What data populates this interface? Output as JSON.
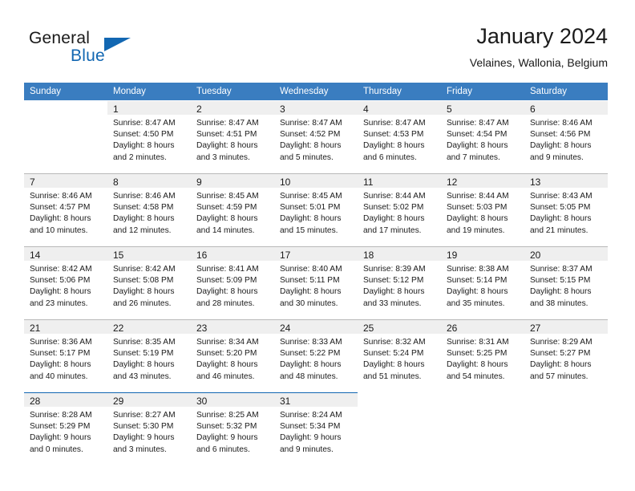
{
  "brand": {
    "word1": "General",
    "word2": "Blue",
    "logo_icon": "triangle-logo"
  },
  "header": {
    "month_title": "January 2024",
    "location": "Velaines, Wallonia, Belgium"
  },
  "calendar": {
    "weekday_headers": [
      "Sunday",
      "Monday",
      "Tuesday",
      "Wednesday",
      "Thursday",
      "Friday",
      "Saturday"
    ],
    "weeks": [
      [
        {
          "day": "",
          "lines": []
        },
        {
          "day": "1",
          "lines": [
            "Sunrise: 8:47 AM",
            "Sunset: 4:50 PM",
            "Daylight: 8 hours",
            "and 2 minutes."
          ]
        },
        {
          "day": "2",
          "lines": [
            "Sunrise: 8:47 AM",
            "Sunset: 4:51 PM",
            "Daylight: 8 hours",
            "and 3 minutes."
          ]
        },
        {
          "day": "3",
          "lines": [
            "Sunrise: 8:47 AM",
            "Sunset: 4:52 PM",
            "Daylight: 8 hours",
            "and 5 minutes."
          ]
        },
        {
          "day": "4",
          "lines": [
            "Sunrise: 8:47 AM",
            "Sunset: 4:53 PM",
            "Daylight: 8 hours",
            "and 6 minutes."
          ]
        },
        {
          "day": "5",
          "lines": [
            "Sunrise: 8:47 AM",
            "Sunset: 4:54 PM",
            "Daylight: 8 hours",
            "and 7 minutes."
          ]
        },
        {
          "day": "6",
          "lines": [
            "Sunrise: 8:46 AM",
            "Sunset: 4:56 PM",
            "Daylight: 8 hours",
            "and 9 minutes."
          ]
        }
      ],
      [
        {
          "day": "7",
          "lines": [
            "Sunrise: 8:46 AM",
            "Sunset: 4:57 PM",
            "Daylight: 8 hours",
            "and 10 minutes."
          ]
        },
        {
          "day": "8",
          "lines": [
            "Sunrise: 8:46 AM",
            "Sunset: 4:58 PM",
            "Daylight: 8 hours",
            "and 12 minutes."
          ]
        },
        {
          "day": "9",
          "lines": [
            "Sunrise: 8:45 AM",
            "Sunset: 4:59 PM",
            "Daylight: 8 hours",
            "and 14 minutes."
          ]
        },
        {
          "day": "10",
          "lines": [
            "Sunrise: 8:45 AM",
            "Sunset: 5:01 PM",
            "Daylight: 8 hours",
            "and 15 minutes."
          ]
        },
        {
          "day": "11",
          "lines": [
            "Sunrise: 8:44 AM",
            "Sunset: 5:02 PM",
            "Daylight: 8 hours",
            "and 17 minutes."
          ]
        },
        {
          "day": "12",
          "lines": [
            "Sunrise: 8:44 AM",
            "Sunset: 5:03 PM",
            "Daylight: 8 hours",
            "and 19 minutes."
          ]
        },
        {
          "day": "13",
          "lines": [
            "Sunrise: 8:43 AM",
            "Sunset: 5:05 PM",
            "Daylight: 8 hours",
            "and 21 minutes."
          ]
        }
      ],
      [
        {
          "day": "14",
          "lines": [
            "Sunrise: 8:42 AM",
            "Sunset: 5:06 PM",
            "Daylight: 8 hours",
            "and 23 minutes."
          ]
        },
        {
          "day": "15",
          "lines": [
            "Sunrise: 8:42 AM",
            "Sunset: 5:08 PM",
            "Daylight: 8 hours",
            "and 26 minutes."
          ]
        },
        {
          "day": "16",
          "lines": [
            "Sunrise: 8:41 AM",
            "Sunset: 5:09 PM",
            "Daylight: 8 hours",
            "and 28 minutes."
          ]
        },
        {
          "day": "17",
          "lines": [
            "Sunrise: 8:40 AM",
            "Sunset: 5:11 PM",
            "Daylight: 8 hours",
            "and 30 minutes."
          ]
        },
        {
          "day": "18",
          "lines": [
            "Sunrise: 8:39 AM",
            "Sunset: 5:12 PM",
            "Daylight: 8 hours",
            "and 33 minutes."
          ]
        },
        {
          "day": "19",
          "lines": [
            "Sunrise: 8:38 AM",
            "Sunset: 5:14 PM",
            "Daylight: 8 hours",
            "and 35 minutes."
          ]
        },
        {
          "day": "20",
          "lines": [
            "Sunrise: 8:37 AM",
            "Sunset: 5:15 PM",
            "Daylight: 8 hours",
            "and 38 minutes."
          ]
        }
      ],
      [
        {
          "day": "21",
          "lines": [
            "Sunrise: 8:36 AM",
            "Sunset: 5:17 PM",
            "Daylight: 8 hours",
            "and 40 minutes."
          ]
        },
        {
          "day": "22",
          "lines": [
            "Sunrise: 8:35 AM",
            "Sunset: 5:19 PM",
            "Daylight: 8 hours",
            "and 43 minutes."
          ]
        },
        {
          "day": "23",
          "lines": [
            "Sunrise: 8:34 AM",
            "Sunset: 5:20 PM",
            "Daylight: 8 hours",
            "and 46 minutes."
          ]
        },
        {
          "day": "24",
          "lines": [
            "Sunrise: 8:33 AM",
            "Sunset: 5:22 PM",
            "Daylight: 8 hours",
            "and 48 minutes."
          ]
        },
        {
          "day": "25",
          "lines": [
            "Sunrise: 8:32 AM",
            "Sunset: 5:24 PM",
            "Daylight: 8 hours",
            "and 51 minutes."
          ]
        },
        {
          "day": "26",
          "lines": [
            "Sunrise: 8:31 AM",
            "Sunset: 5:25 PM",
            "Daylight: 8 hours",
            "and 54 minutes."
          ]
        },
        {
          "day": "27",
          "lines": [
            "Sunrise: 8:29 AM",
            "Sunset: 5:27 PM",
            "Daylight: 8 hours",
            "and 57 minutes."
          ]
        }
      ],
      [
        {
          "day": "28",
          "lines": [
            "Sunrise: 8:28 AM",
            "Sunset: 5:29 PM",
            "Daylight: 9 hours",
            "and 0 minutes."
          ]
        },
        {
          "day": "29",
          "lines": [
            "Sunrise: 8:27 AM",
            "Sunset: 5:30 PM",
            "Daylight: 9 hours",
            "and 3 minutes."
          ]
        },
        {
          "day": "30",
          "lines": [
            "Sunrise: 8:25 AM",
            "Sunset: 5:32 PM",
            "Daylight: 9 hours",
            "and 6 minutes."
          ]
        },
        {
          "day": "31",
          "lines": [
            "Sunrise: 8:24 AM",
            "Sunset: 5:34 PM",
            "Daylight: 9 hours",
            "and 9 minutes."
          ]
        },
        {
          "day": "",
          "lines": []
        },
        {
          "day": "",
          "lines": []
        },
        {
          "day": "",
          "lines": []
        }
      ]
    ]
  },
  "colors": {
    "header_blue": "#3a7dc0",
    "brand_blue": "#1267b2",
    "day_band_gray": "#efefef",
    "rule_gray": "#b9b9b9"
  }
}
